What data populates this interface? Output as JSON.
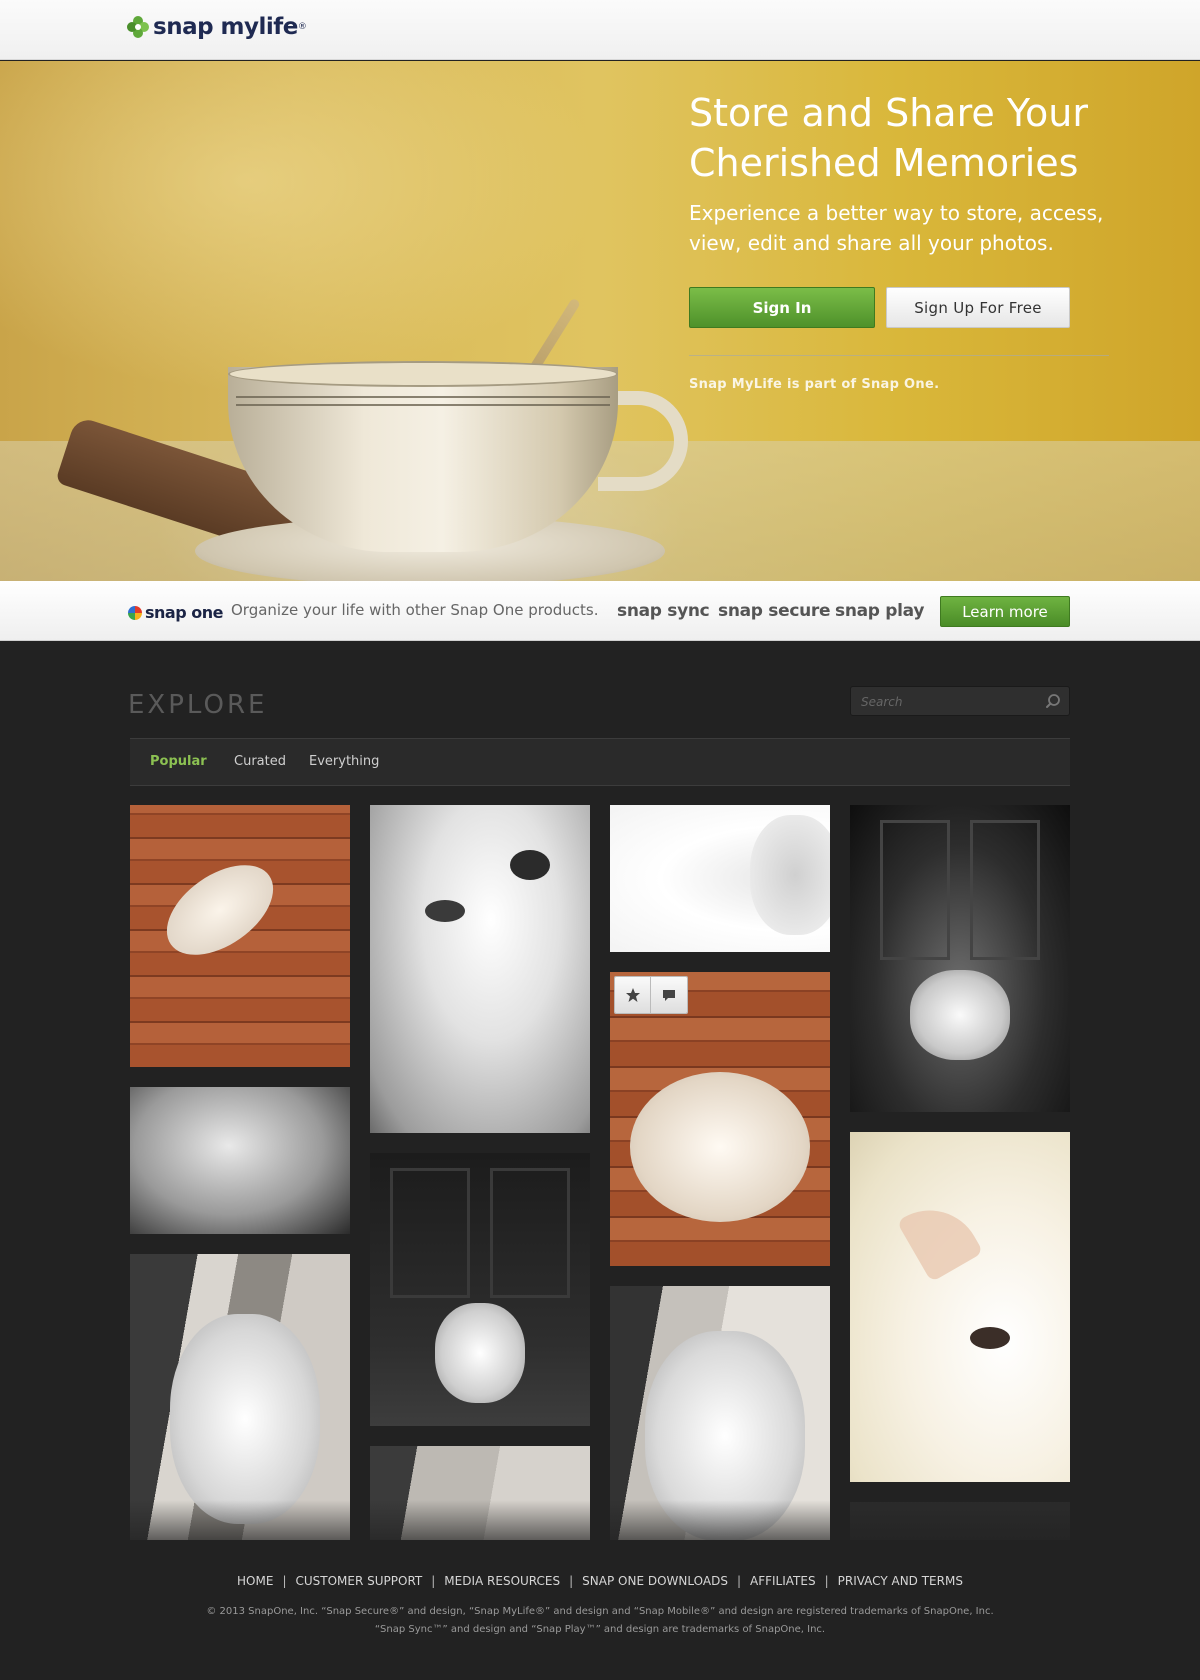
{
  "header": {
    "logo_text": "snap mylife",
    "logo_reg": "®"
  },
  "hero": {
    "title_line1": "Store and Share Your",
    "title_line2": "Cherished Memories",
    "subtitle": "Experience a better way to store, access, view, edit and share all your photos.",
    "signin_label": "Sign In",
    "signup_label": "Sign Up For Free",
    "note": "Snap MyLife is part of Snap One."
  },
  "strip": {
    "logo_text": "snap one",
    "tagline": "Organize your life with other Snap One products.",
    "products": [
      "snap sync",
      "snap secure",
      "snap play"
    ],
    "learn_more_label": "Learn more"
  },
  "explore": {
    "title": "EXPLORE",
    "search_placeholder": "Search",
    "tabs": [
      {
        "label": "Popular",
        "active": true
      },
      {
        "label": "Curated",
        "active": false
      },
      {
        "label": "Everything",
        "active": false
      }
    ]
  },
  "footer": {
    "links": [
      "HOME",
      "CUSTOMER SUPPORT",
      "MEDIA RESOURCES",
      "SNAP ONE DOWNLOADS",
      "AFFILIATES",
      "PRIVACY AND TERMS"
    ],
    "separator": "|",
    "legal_line1": "© 2013 SnapOne, Inc. “Snap Secure®” and design, “Snap MyLife®” and design and “Snap Mobile®” and design are registered trademarks of SnapOne, Inc.",
    "legal_line2": "“Snap Sync™” and design and “Snap Play™” and design are trademarks of SnapOne, Inc."
  },
  "colors": {
    "brand_green": "#5fa83a",
    "active_tab": "#8cc152",
    "page_dark": "#222222"
  },
  "icons": [
    "star-icon",
    "comment-icon",
    "search-icon"
  ]
}
